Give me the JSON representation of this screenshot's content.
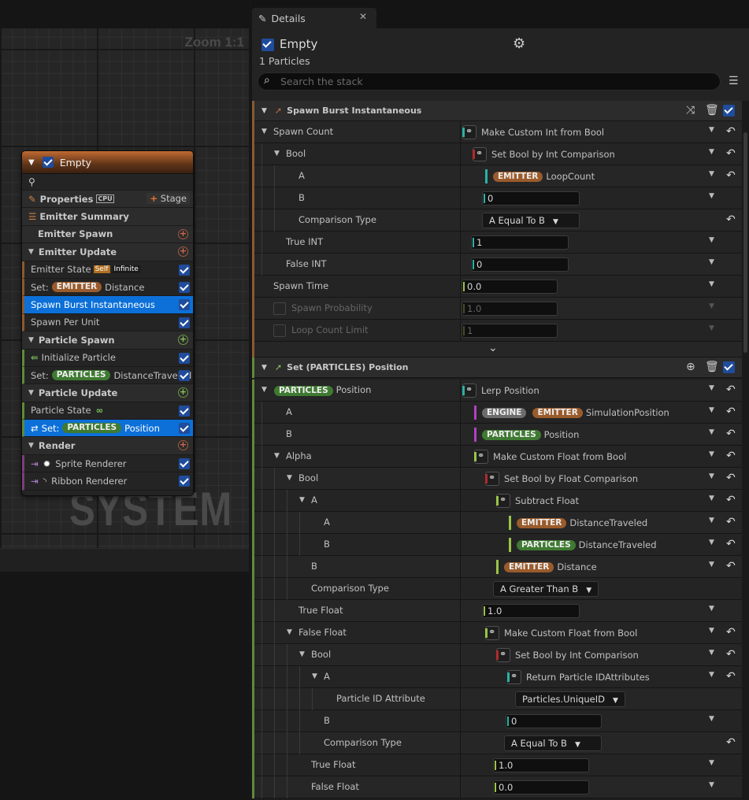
{
  "graph": {
    "zoom": "Zoom 1:1",
    "watermark": "SYSTEM",
    "node": {
      "title": "Empty",
      "properties_label": "Properties",
      "cpu_label": "CPU",
      "stage_label": "Stage",
      "sections": {
        "emitter_summary": "Emitter Summary",
        "emitter_spawn": "Emitter Spawn",
        "emitter_update": "Emitter Update",
        "particle_spawn": "Particle Spawn",
        "particle_update": "Particle Update",
        "render": "Render"
      },
      "items": {
        "emitter_state": "Emitter State",
        "self_tag": "Self",
        "infinite_tag": "Infinite",
        "set_label": "Set:",
        "emitter_pill": "EMITTER",
        "distance": "Distance",
        "spawn_burst": "Spawn Burst Instantaneous",
        "spawn_per_unit": "Spawn Per Unit",
        "initialize_particle": "Initialize Particle",
        "particles_pill": "PARTICLES",
        "distance_traveled": "DistanceTraveled",
        "particle_state": "Particle State",
        "position": "Position",
        "sprite_renderer": "Sprite Renderer",
        "ribbon_renderer": "Ribbon Renderer"
      }
    }
  },
  "details": {
    "tab_label": "Details",
    "emitter_name": "Empty",
    "particle_count": "1 Particles",
    "search_placeholder": "Search the stack",
    "module1": {
      "title": "Spawn Burst Instantaneous",
      "rows": {
        "spawn_count": "Spawn Count",
        "make_custom_int": "Make Custom Int from Bool",
        "bool": "Bool",
        "set_bool_int": "Set Bool by Int Comparison",
        "a": "A",
        "emitter": "EMITTER",
        "loopcount": "LoopCount",
        "b": "B",
        "b_val": "0",
        "comparison_type": "Comparison Type",
        "cmp_val": "A Equal To B",
        "true_int": "True INT",
        "true_int_val": "1",
        "false_int": "False INT",
        "false_int_val": "0",
        "spawn_time": "Spawn Time",
        "spawn_time_val": "0.0",
        "spawn_probability": "Spawn Probability",
        "spawn_probability_val": "1.0",
        "loop_count_limit": "Loop Count Limit",
        "loop_count_limit_val": "1"
      }
    },
    "module2": {
      "title": "Set (PARTICLES) Position",
      "rows": {
        "particles": "PARTICLES",
        "position": "Position",
        "lerp_position": "Lerp Position",
        "a": "A",
        "engine": "ENGINE",
        "emitter": "EMITTER",
        "simulation_position": "SimulationPosition",
        "b": "B",
        "alpha": "Alpha",
        "make_custom_float": "Make Custom Float from Bool",
        "bool": "Bool",
        "set_bool_float": "Set Bool by Float Comparison",
        "subtract_float": "Subtract Float",
        "distance_traveled": "DistanceTraveled",
        "distance": "Distance",
        "comparison_type": "Comparison Type",
        "cmp_greater": "A Greater Than B",
        "true_float": "True Float",
        "true_float_val": "1.0",
        "false_float": "False Float",
        "set_bool_int": "Set Bool by Int Comparison",
        "return_particle_id": "Return Particle IDAttributes",
        "particle_id_attribute": "Particle ID Attribute",
        "unique_id": "Particles.UniqueID",
        "b_val": "0",
        "cmp_equal": "A Equal To B",
        "true_float2_val": "1.0",
        "false_float_val": "0.0"
      }
    }
  }
}
